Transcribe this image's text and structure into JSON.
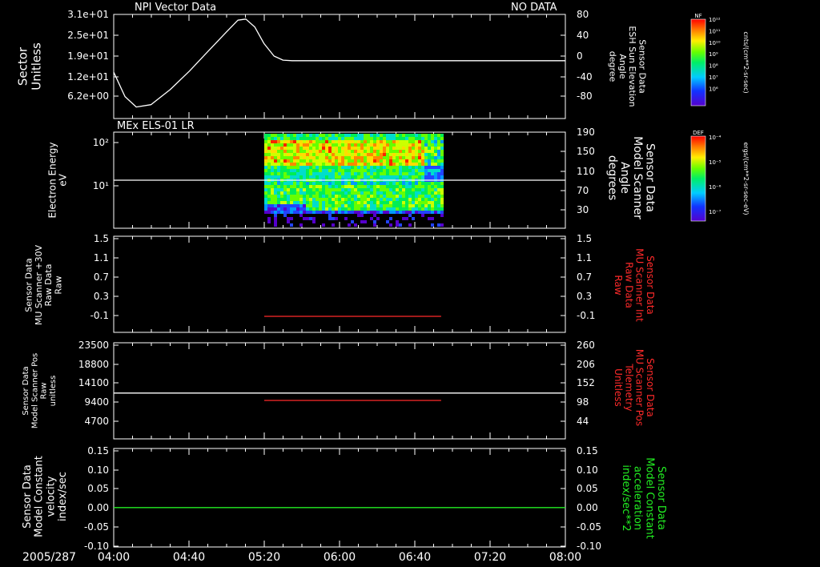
{
  "date_label": "2005/287",
  "time_ticks": [
    "04:00",
    "04:40",
    "05:20",
    "06:00",
    "06:40",
    "07:20",
    "08:00"
  ],
  "colors": {
    "background": "#000000",
    "axes": "#ffffff",
    "red": "#ff2a2a",
    "green": "#22ee22"
  },
  "colorbars": [
    {
      "tag": "NF",
      "units": "cnts/(cm**2-sr-sec)",
      "ticks": [
        "10¹²",
        "10¹¹",
        "10¹⁰",
        "10⁹",
        "10⁸",
        "10⁷",
        "10⁶"
      ]
    },
    {
      "tag": "DEF",
      "units": "ergs/(cm**2-sr-sec-eV)",
      "ticks": [
        "10⁻⁴",
        "10⁻⁵",
        "10⁻⁶",
        "10⁻⁷"
      ]
    }
  ],
  "chart_data": [
    {
      "type": "line",
      "title": "NPI Vector Data",
      "title_right": "NO DATA",
      "ylabel": [
        "Sector",
        "Unitless"
      ],
      "left_ticks": [
        "3.1e+01",
        "2.5e+01",
        "1.9e+01",
        "1.2e+01",
        "6.2e+00"
      ],
      "right_ticks": [
        "80",
        "40",
        "0",
        "-40",
        "-80"
      ],
      "ylabel_right": [
        "Sensor Data",
        "ESH Sun Elevation",
        "Angle",
        "degree"
      ],
      "ylim_right": [
        -100,
        80
      ],
      "x_hours": [
        4.0,
        4.1,
        4.2,
        4.33,
        4.5,
        4.67,
        4.83,
        5.0,
        5.1,
        5.17,
        5.25,
        5.33,
        5.42,
        5.5,
        5.58,
        6.0,
        7.0,
        8.0
      ],
      "values": [
        -20,
        -62,
        -80,
        -76,
        -50,
        -18,
        15,
        50,
        70,
        72,
        58,
        30,
        8,
        1,
        0,
        0,
        0,
        0
      ]
    },
    {
      "type": "heatmap",
      "title": "MEx ELS-01 LR",
      "ylabel": [
        "Electron Energy",
        "eV"
      ],
      "left_ticks": [
        "10²",
        "10¹"
      ],
      "right_ticks": [
        "190",
        "150",
        "110",
        "70",
        "30"
      ],
      "ylabel_right": [
        "Sensor Data",
        "Model Scanner",
        "Angle",
        "degrees"
      ],
      "ylim_right": [
        10,
        190
      ],
      "data_start": "05:20",
      "data_end": "06:54",
      "scanner_angle_value": 100
    },
    {
      "type": "line",
      "ylabel": [
        "Sensor Data",
        "MU Scanner +30V",
        "Raw Data",
        "Raw"
      ],
      "left_ticks": [
        "1.5",
        "1.1",
        "0.7",
        "0.3",
        "-0.1"
      ],
      "right_ticks": [
        "1.5",
        "1.1",
        "0.7",
        "0.3",
        "-0.1"
      ],
      "ylabel_right": [
        "Sensor Data",
        "MU Scanner Int",
        "Raw Data",
        "Raw"
      ],
      "ylim": [
        -0.3,
        1.5
      ],
      "series": [
        {
          "color": "red",
          "x_start": "05:20",
          "x_end": "06:54",
          "value": 0.0
        }
      ]
    },
    {
      "type": "line",
      "ylabel": [
        "Sensor Data",
        "Model Scanner Pos",
        "Raw",
        "unitless"
      ],
      "left_ticks": [
        "23500",
        "18800",
        "14100",
        "9400",
        "4700"
      ],
      "right_ticks": [
        "260",
        "206",
        "152",
        "98",
        "44"
      ],
      "ylabel_right": [
        "Sensor Data",
        "MU Scanner Pos",
        "Telemetry",
        "Unitless"
      ],
      "ylim": [
        0,
        23500
      ],
      "ylim_right": [
        -10,
        260
      ],
      "series": [
        {
          "color": "white",
          "x_start": "04:00",
          "x_end": "08:00",
          "value": 11200
        },
        {
          "color": "red",
          "x_start": "05:20",
          "x_end": "06:54",
          "value": 98
        }
      ]
    },
    {
      "type": "line",
      "ylabel": [
        "Sensor Data",
        "Model Constant",
        "velocity",
        "index/sec"
      ],
      "left_ticks": [
        "0.15",
        "0.10",
        "0.05",
        "0.00",
        "-0.05",
        "-0.10"
      ],
      "right_ticks": [
        "0.15",
        "0.10",
        "0.05",
        "0.00",
        "-0.05",
        "-0.10"
      ],
      "ylabel_right": [
        "Sensor Data",
        "Model Constant",
        "acceleration",
        "index/sec**2"
      ],
      "ylim": [
        -0.1,
        0.15
      ],
      "series": [
        {
          "color": "green",
          "x_start": "04:00",
          "x_end": "08:00",
          "value": 0.0
        }
      ]
    }
  ]
}
